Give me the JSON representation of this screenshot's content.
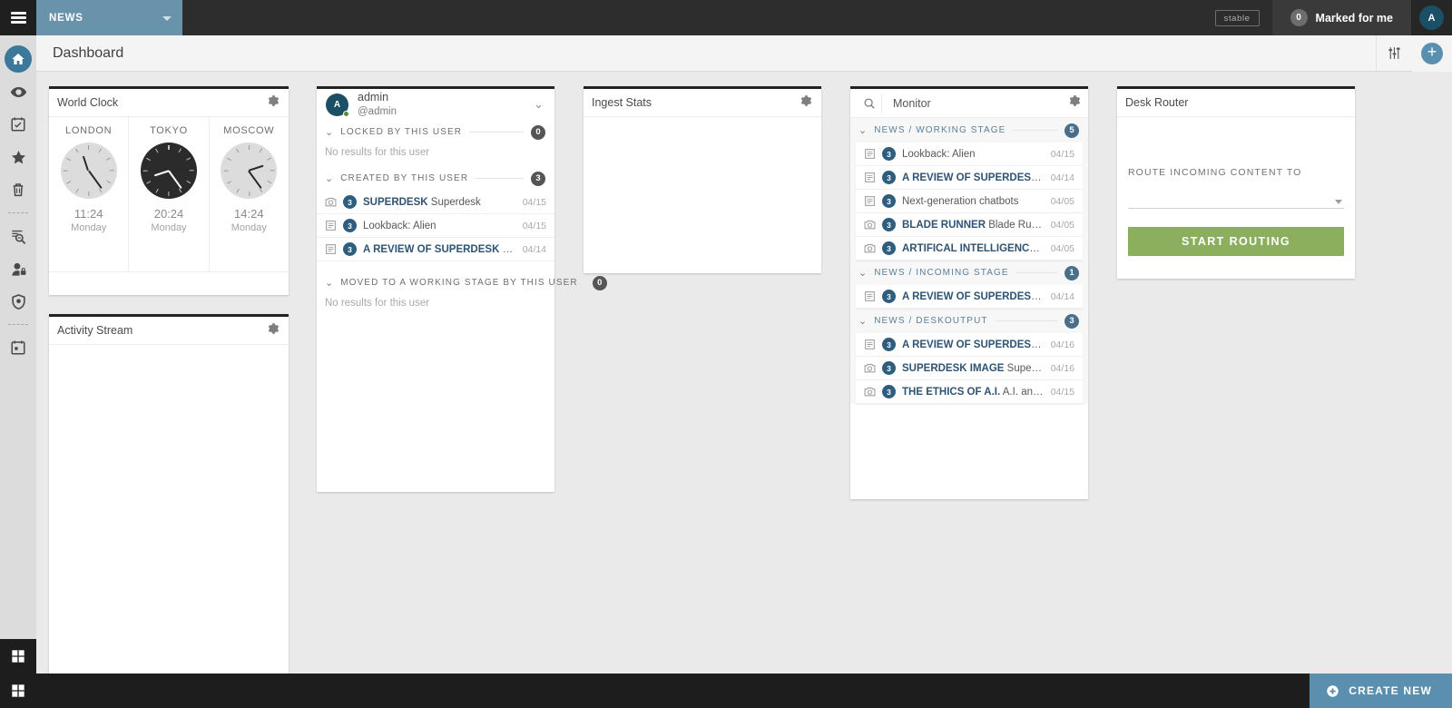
{
  "topbar": {
    "menu_icon": "hamburger-icon",
    "desk_name": "NEWS",
    "desk_caret_icon": "chevron-down-icon",
    "stable_chip": "stable",
    "marked_count": "0",
    "marked_label": "Marked for me",
    "avatar_initial": "A"
  },
  "rail": {
    "items": [
      {
        "icon": "home-icon",
        "name": "sidebar-item-dashboard",
        "active": true
      },
      {
        "icon": "eye-icon",
        "name": "sidebar-item-monitoring",
        "active": false
      },
      {
        "icon": "tasks-icon",
        "name": "sidebar-item-tasks",
        "active": false
      },
      {
        "icon": "star-icon",
        "name": "sidebar-item-highlights",
        "active": false
      },
      {
        "icon": "trash-icon",
        "name": "sidebar-item-spike",
        "active": false
      },
      {
        "icon": "search-analytics-icon",
        "name": "sidebar-item-search",
        "active": false
      },
      {
        "icon": "user-lock-icon",
        "name": "sidebar-item-user-management",
        "active": false
      },
      {
        "icon": "shield-icon",
        "name": "sidebar-item-privileges",
        "active": false
      },
      {
        "icon": "calendar-icon",
        "name": "sidebar-item-planning",
        "active": false
      }
    ],
    "bottom_icon": "grid-windows-icon"
  },
  "subheader": {
    "page_title": "Dashboard",
    "settings_icon": "sliders-icon",
    "add_icon": "plus-icon"
  },
  "world_clock": {
    "title": "World Clock",
    "gear_icon": "gear-icon",
    "clocks": [
      {
        "city": "LONDON",
        "time": "11:24",
        "day": "Monday",
        "dark": false,
        "hour_deg": 342,
        "minute_deg": 144
      },
      {
        "city": "TOKYO",
        "time": "20:24",
        "day": "Monday",
        "dark": true,
        "hour_deg": 252,
        "minute_deg": 144
      },
      {
        "city": "MOSCOW",
        "time": "14:24",
        "day": "Monday",
        "dark": false,
        "hour_deg": 72,
        "minute_deg": 144
      }
    ]
  },
  "activity_stream": {
    "title": "Activity Stream",
    "gear_icon": "gear-icon"
  },
  "ingest_stats": {
    "title": "Ingest Stats",
    "gear_icon": "gear-icon"
  },
  "user_activity": {
    "avatar_initial": "A",
    "name": "admin",
    "handle": "@admin",
    "collapse_icon": "chevron-down-icon",
    "sections": [
      {
        "label": "LOCKED BY THIS USER",
        "badge": "0",
        "chevron_icon": "chevron-down-icon",
        "empty_text": "No results for this user",
        "items": []
      },
      {
        "label": "CREATED BY THIS USER",
        "badge": "3",
        "chevron_icon": "chevron-down-icon",
        "empty_text": "",
        "items": [
          {
            "icon": "photo-icon",
            "count": "3",
            "headline": "SUPERDESK",
            "slugline": "Superdesk",
            "date": "04/15"
          },
          {
            "icon": "text-icon",
            "count": "3",
            "headline": "",
            "slugline": "Lookback: Alien",
            "date": "04/15"
          },
          {
            "icon": "text-icon",
            "count": "3",
            "headline": "A REVIEW OF SUPERDESK",
            "slugline": "Superdes…",
            "date": "04/14"
          }
        ]
      },
      {
        "label": "MOVED TO A WORKING STAGE BY THIS USER",
        "badge": "0",
        "chevron_icon": "chevron-down-icon",
        "empty_text": "No results for this user",
        "items": []
      }
    ]
  },
  "monitor": {
    "search_icon": "search-icon",
    "search_value": "Monitor",
    "search_placeholder": "Search",
    "gear_icon": "gear-icon",
    "groups": [
      {
        "label": "NEWS / WORKING STAGE",
        "badge": "5",
        "chevron_icon": "chevron-down-icon",
        "items": [
          {
            "icon": "text-icon",
            "count": "3",
            "headline": "",
            "slugline": "Lookback: Alien",
            "date": "04/15"
          },
          {
            "icon": "text-icon",
            "count": "3",
            "headline": "A REVIEW OF SUPERDESK",
            "slugline": "Superd…",
            "date": "04/14"
          },
          {
            "icon": "text-icon",
            "count": "3",
            "headline": "",
            "slugline": "Next-generation chatbots",
            "date": "04/05"
          },
          {
            "icon": "photo-icon",
            "count": "3",
            "headline": "BLADE RUNNER",
            "slugline": "Blade Runner",
            "date": "04/05"
          },
          {
            "icon": "photo-icon",
            "count": "3",
            "headline": "ARTIFICAL INTELLIGENCE AND SC…",
            "slugline": "",
            "date": "04/05"
          }
        ]
      },
      {
        "label": "NEWS / INCOMING STAGE",
        "badge": "1",
        "chevron_icon": "chevron-down-icon",
        "items": [
          {
            "icon": "text-icon",
            "count": "3",
            "headline": "A REVIEW OF SUPERDESK",
            "slugline": "Superd…",
            "date": "04/14"
          }
        ]
      },
      {
        "label": "NEWS / DESKOUTPUT",
        "badge": "3",
        "chevron_icon": "chevron-down-icon",
        "items": [
          {
            "icon": "text-icon",
            "count": "3",
            "headline": "A REVIEW OF SUPERDESK",
            "slugline": "Superd…",
            "date": "04/16"
          },
          {
            "icon": "photo-icon",
            "count": "3",
            "headline": "SUPERDESK IMAGE",
            "slugline": "Superdesk",
            "date": "04/16"
          },
          {
            "icon": "photo-icon",
            "count": "3",
            "headline": "THE ETHICS OF A.I.",
            "slugline": "A.I. and Ethics",
            "date": "04/15"
          }
        ]
      }
    ]
  },
  "desk_router": {
    "title": "Desk Router",
    "route_label": "ROUTE INCOMING CONTENT TO",
    "select_value": "",
    "select_caret_icon": "chevron-down-icon",
    "button_label": "START ROUTING"
  },
  "bottombar": {
    "apps_icon": "grid-windows-icon",
    "create_icon": "plus-circle-icon",
    "create_label": "CREATE NEW"
  },
  "colors": {
    "desk_accent": "#6992ab",
    "brand_blue": "#3b7899",
    "routing_green": "#8caf5f",
    "badge_blue": "#2e5d7d",
    "dark_chrome": "#2d2d2d"
  }
}
